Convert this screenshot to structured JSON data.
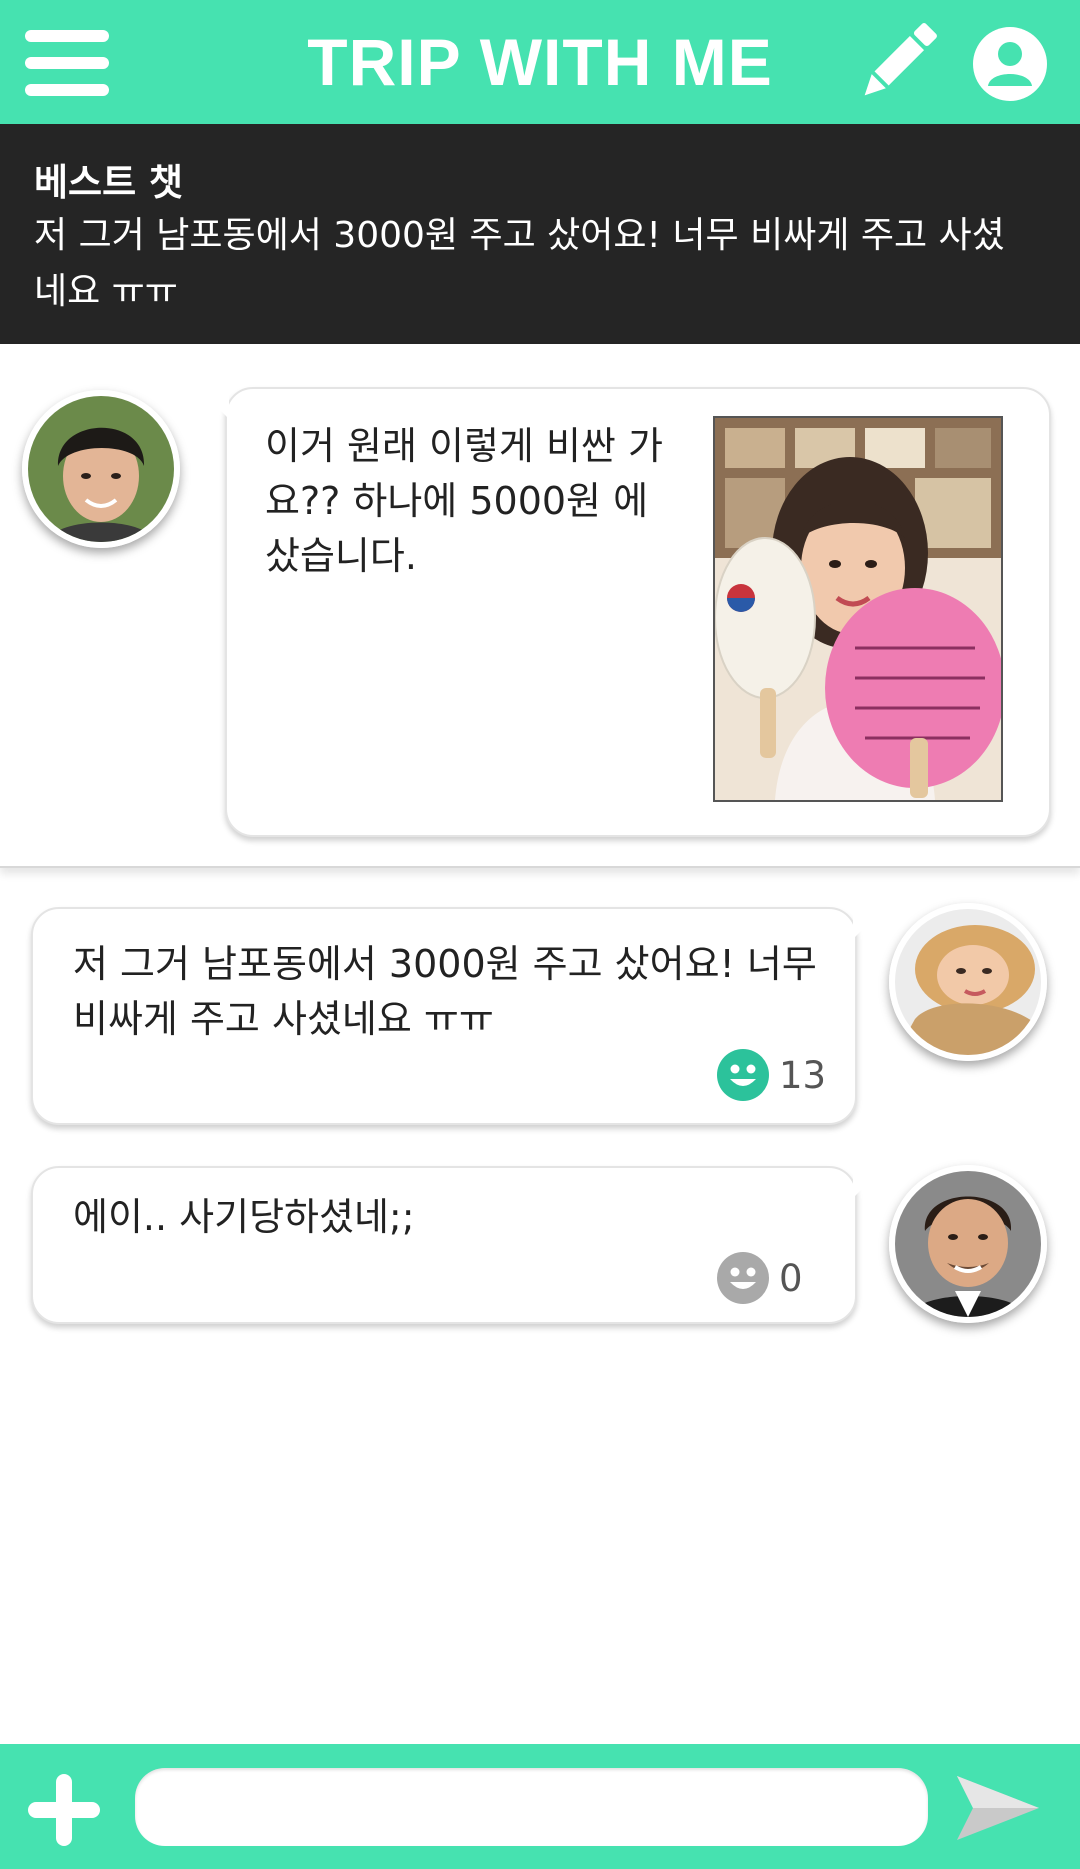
{
  "header": {
    "title": "TRIP WITH ME",
    "menu_icon": "hamburger-menu-icon",
    "edit_icon": "pencil-icon",
    "profile_icon": "user-profile-icon"
  },
  "best_chat": {
    "title": "베스트 챗",
    "text": "저 그거 남포동에서  3000원 주고 샀어요! 너무 비싸게 주고 사셨네요 ㅠㅠ"
  },
  "post": {
    "text": "이거 원래 이렇게 비싼 가요?? 하나에 5000원 에 샀습니다."
  },
  "comments": [
    {
      "text": "저 그거 남포동에서 3000원 주고 샀어요! 너무 비싸게 주고 사셨네요 ㅠㅠ",
      "likes": "13",
      "like_color": "#2cc29b"
    },
    {
      "text": "에이.. 사기당하셨네;;",
      "likes": "0",
      "like_color": "#a9a9a9"
    }
  ],
  "footer": {
    "input_placeholder": "",
    "input_value": "",
    "plus_icon": "plus-icon",
    "send_icon": "send-icon"
  },
  "colors": {
    "accent": "#46e2b0",
    "dark_banner": "#252525"
  }
}
